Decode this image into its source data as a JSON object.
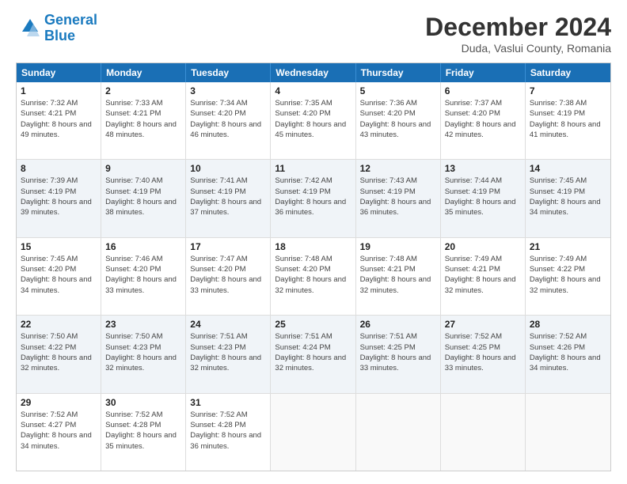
{
  "logo": {
    "line1": "General",
    "line2": "Blue"
  },
  "title": "December 2024",
  "location": "Duda, Vaslui County, Romania",
  "days_of_week": [
    "Sunday",
    "Monday",
    "Tuesday",
    "Wednesday",
    "Thursday",
    "Friday",
    "Saturday"
  ],
  "weeks": [
    [
      {
        "day": "1",
        "sunrise": "7:32 AM",
        "sunset": "4:21 PM",
        "daylight": "8 hours and 49 minutes."
      },
      {
        "day": "2",
        "sunrise": "7:33 AM",
        "sunset": "4:21 PM",
        "daylight": "8 hours and 48 minutes."
      },
      {
        "day": "3",
        "sunrise": "7:34 AM",
        "sunset": "4:20 PM",
        "daylight": "8 hours and 46 minutes."
      },
      {
        "day": "4",
        "sunrise": "7:35 AM",
        "sunset": "4:20 PM",
        "daylight": "8 hours and 45 minutes."
      },
      {
        "day": "5",
        "sunrise": "7:36 AM",
        "sunset": "4:20 PM",
        "daylight": "8 hours and 43 minutes."
      },
      {
        "day": "6",
        "sunrise": "7:37 AM",
        "sunset": "4:20 PM",
        "daylight": "8 hours and 42 minutes."
      },
      {
        "day": "7",
        "sunrise": "7:38 AM",
        "sunset": "4:19 PM",
        "daylight": "8 hours and 41 minutes."
      }
    ],
    [
      {
        "day": "8",
        "sunrise": "7:39 AM",
        "sunset": "4:19 PM",
        "daylight": "8 hours and 39 minutes."
      },
      {
        "day": "9",
        "sunrise": "7:40 AM",
        "sunset": "4:19 PM",
        "daylight": "8 hours and 38 minutes."
      },
      {
        "day": "10",
        "sunrise": "7:41 AM",
        "sunset": "4:19 PM",
        "daylight": "8 hours and 37 minutes."
      },
      {
        "day": "11",
        "sunrise": "7:42 AM",
        "sunset": "4:19 PM",
        "daylight": "8 hours and 36 minutes."
      },
      {
        "day": "12",
        "sunrise": "7:43 AM",
        "sunset": "4:19 PM",
        "daylight": "8 hours and 36 minutes."
      },
      {
        "day": "13",
        "sunrise": "7:44 AM",
        "sunset": "4:19 PM",
        "daylight": "8 hours and 35 minutes."
      },
      {
        "day": "14",
        "sunrise": "7:45 AM",
        "sunset": "4:19 PM",
        "daylight": "8 hours and 34 minutes."
      }
    ],
    [
      {
        "day": "15",
        "sunrise": "7:45 AM",
        "sunset": "4:20 PM",
        "daylight": "8 hours and 34 minutes."
      },
      {
        "day": "16",
        "sunrise": "7:46 AM",
        "sunset": "4:20 PM",
        "daylight": "8 hours and 33 minutes."
      },
      {
        "day": "17",
        "sunrise": "7:47 AM",
        "sunset": "4:20 PM",
        "daylight": "8 hours and 33 minutes."
      },
      {
        "day": "18",
        "sunrise": "7:48 AM",
        "sunset": "4:20 PM",
        "daylight": "8 hours and 32 minutes."
      },
      {
        "day": "19",
        "sunrise": "7:48 AM",
        "sunset": "4:21 PM",
        "daylight": "8 hours and 32 minutes."
      },
      {
        "day": "20",
        "sunrise": "7:49 AM",
        "sunset": "4:21 PM",
        "daylight": "8 hours and 32 minutes."
      },
      {
        "day": "21",
        "sunrise": "7:49 AM",
        "sunset": "4:22 PM",
        "daylight": "8 hours and 32 minutes."
      }
    ],
    [
      {
        "day": "22",
        "sunrise": "7:50 AM",
        "sunset": "4:22 PM",
        "daylight": "8 hours and 32 minutes."
      },
      {
        "day": "23",
        "sunrise": "7:50 AM",
        "sunset": "4:23 PM",
        "daylight": "8 hours and 32 minutes."
      },
      {
        "day": "24",
        "sunrise": "7:51 AM",
        "sunset": "4:23 PM",
        "daylight": "8 hours and 32 minutes."
      },
      {
        "day": "25",
        "sunrise": "7:51 AM",
        "sunset": "4:24 PM",
        "daylight": "8 hours and 32 minutes."
      },
      {
        "day": "26",
        "sunrise": "7:51 AM",
        "sunset": "4:25 PM",
        "daylight": "8 hours and 33 minutes."
      },
      {
        "day": "27",
        "sunrise": "7:52 AM",
        "sunset": "4:25 PM",
        "daylight": "8 hours and 33 minutes."
      },
      {
        "day": "28",
        "sunrise": "7:52 AM",
        "sunset": "4:26 PM",
        "daylight": "8 hours and 34 minutes."
      }
    ],
    [
      {
        "day": "29",
        "sunrise": "7:52 AM",
        "sunset": "4:27 PM",
        "daylight": "8 hours and 34 minutes."
      },
      {
        "day": "30",
        "sunrise": "7:52 AM",
        "sunset": "4:28 PM",
        "daylight": "8 hours and 35 minutes."
      },
      {
        "day": "31",
        "sunrise": "7:52 AM",
        "sunset": "4:28 PM",
        "daylight": "8 hours and 36 minutes."
      },
      null,
      null,
      null,
      null
    ]
  ]
}
